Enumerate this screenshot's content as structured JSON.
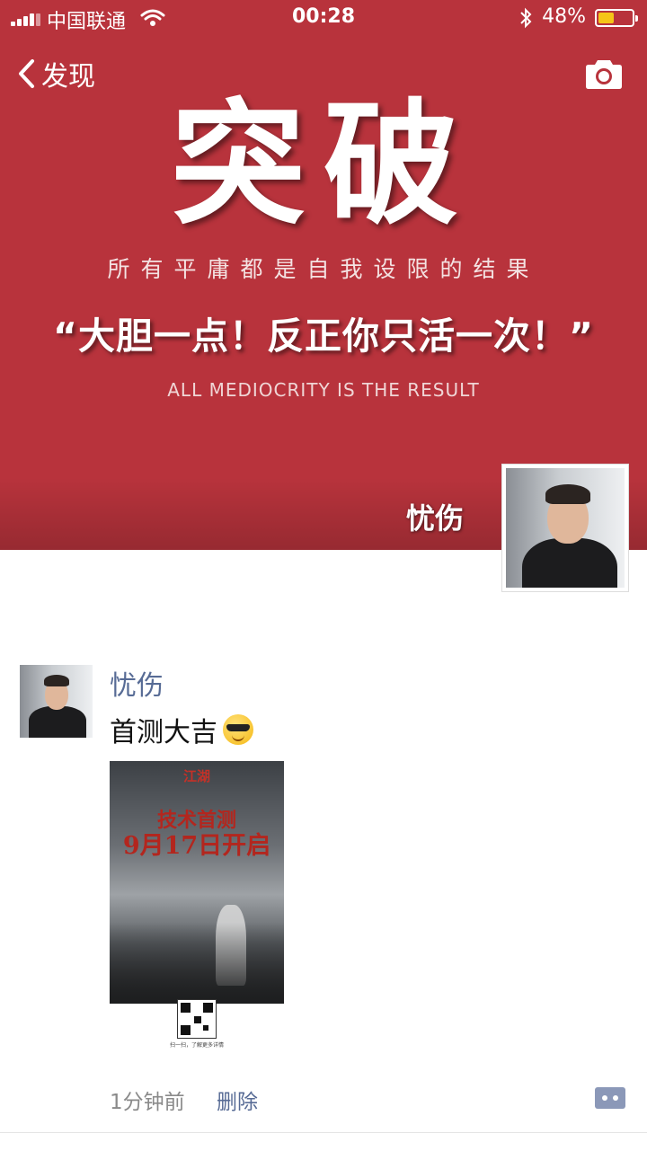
{
  "status_bar": {
    "carrier": "中国联通",
    "time": "00:28",
    "battery_percent": "48%",
    "battery_level": 0.48,
    "battery_color": "#f5c518"
  },
  "nav": {
    "back_label": "发现",
    "back_icon": "chevron-left-icon",
    "camera_icon": "camera-icon"
  },
  "cover": {
    "background_color": "#b8333c",
    "headline": "突破",
    "line1": "所有平庸都是自我设限的结果",
    "line2": "“大胆一点！反正你只活一次！”",
    "line3": "ALL MEDIOCRITY IS THE RESULT",
    "user_name": "忧伤"
  },
  "post": {
    "author": "忧伤",
    "text": "首测大吉",
    "emoji": "sunglasses-smile-emoji",
    "poster": {
      "logo_text": "江湖",
      "headline": "技术首测",
      "date": "9月17日开启",
      "scan_text": "扫一扫，了解更多详情"
    },
    "time": "1分钟前",
    "delete_label": "删除",
    "comment_icon": "comment-icon",
    "name_color": "#576b95"
  }
}
